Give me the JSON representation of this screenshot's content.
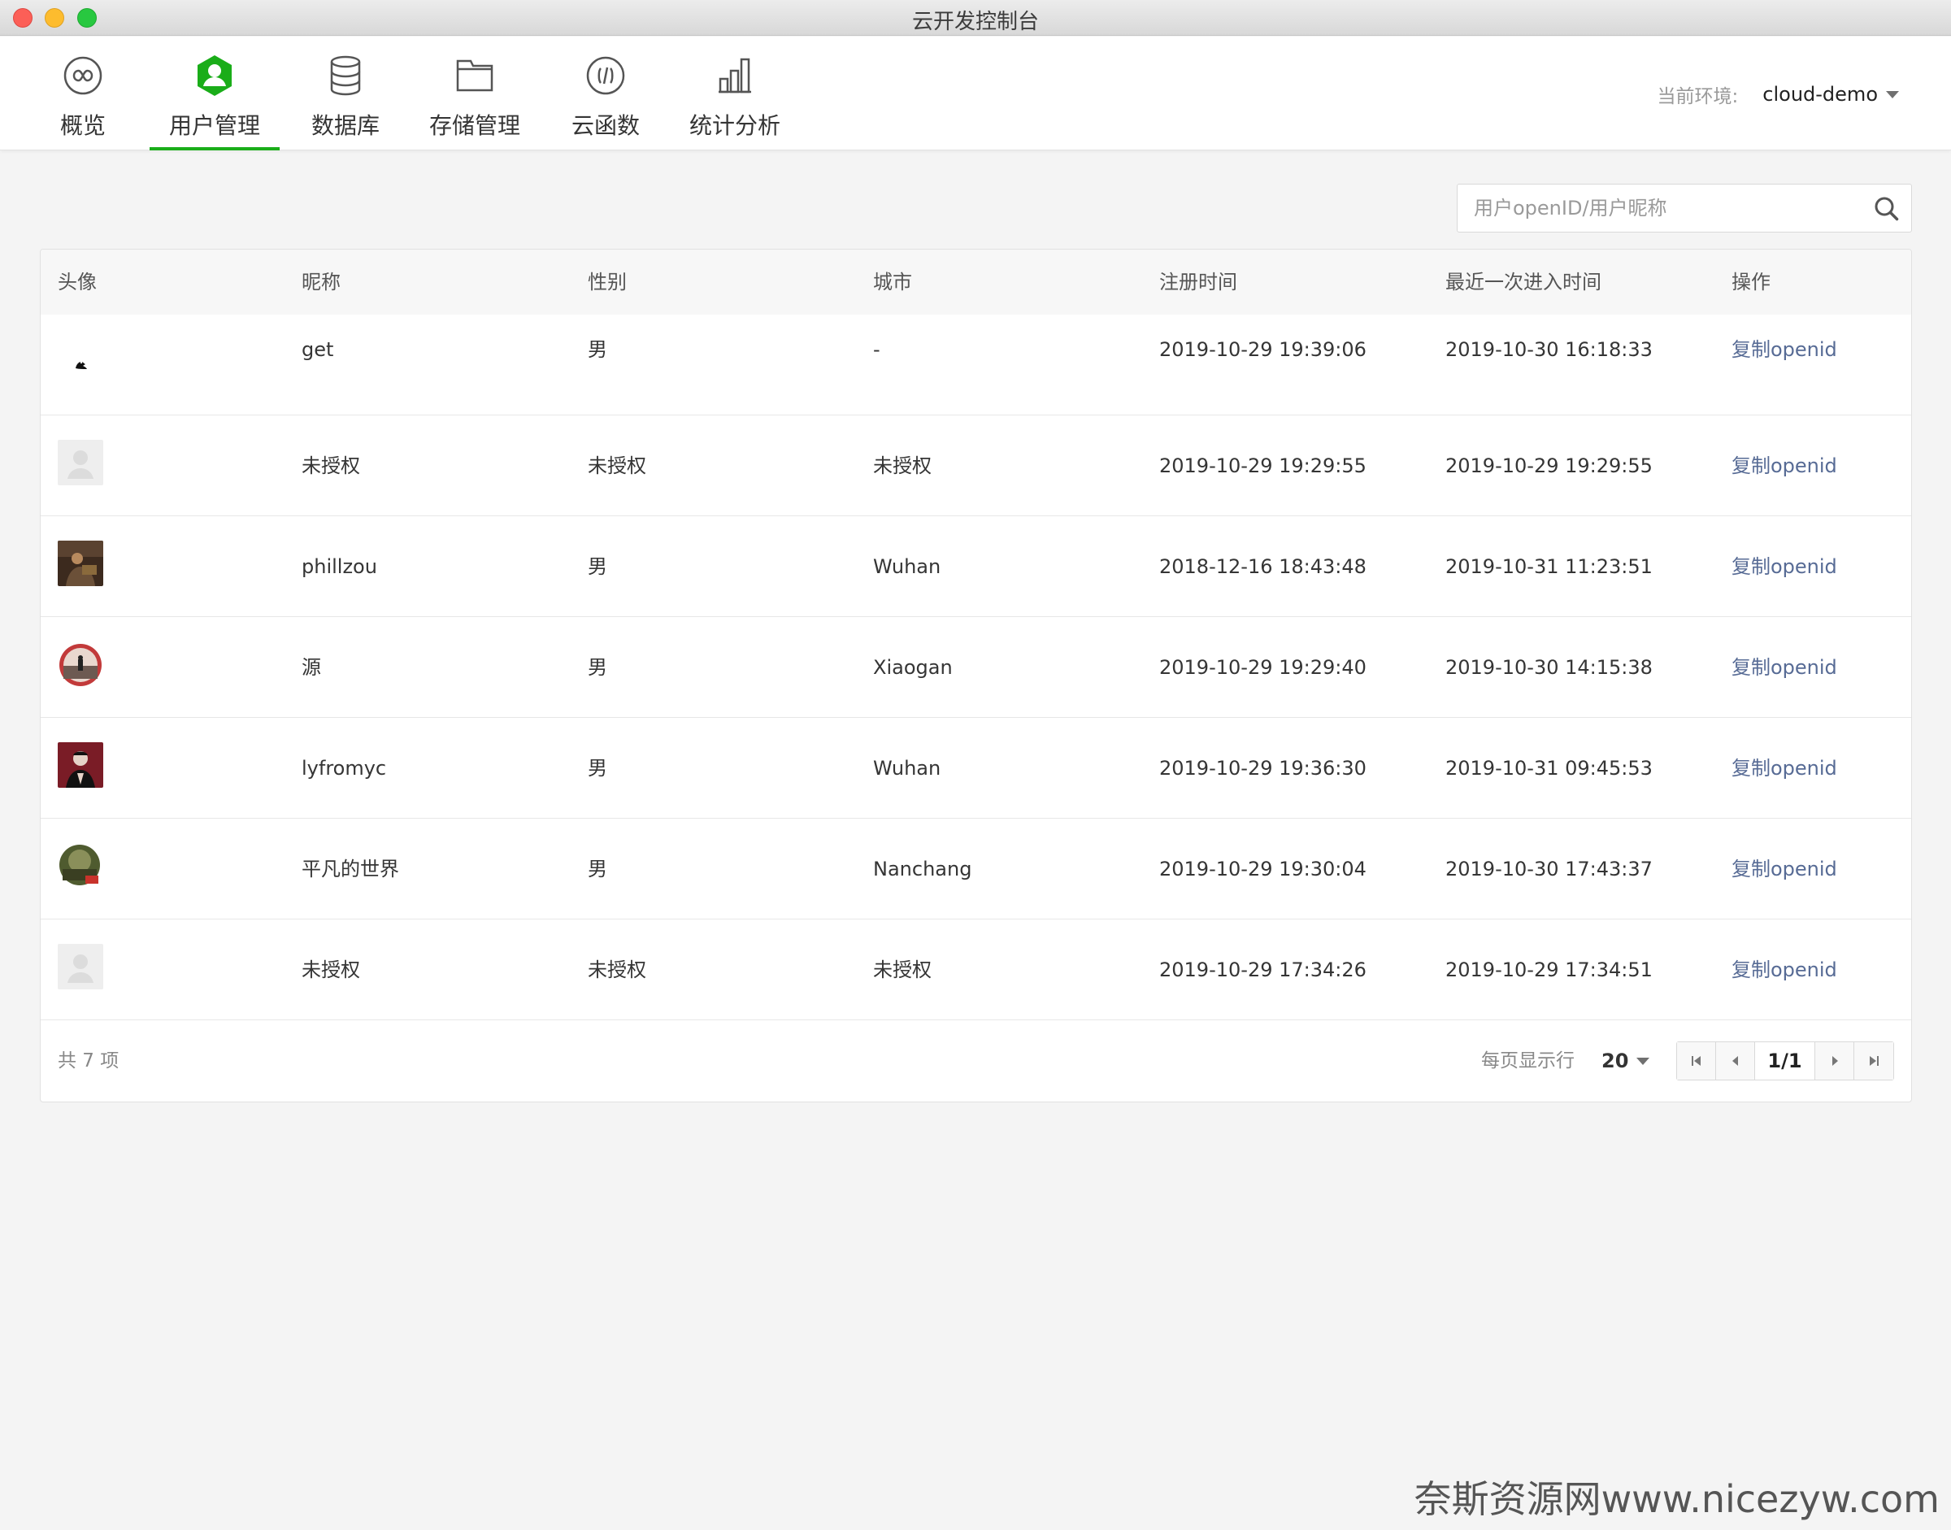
{
  "window": {
    "title": "云开发控制台"
  },
  "nav": {
    "tabs": [
      {
        "label": "概览",
        "icon": "overview-infinity-icon"
      },
      {
        "label": "用户管理",
        "icon": "user-icon",
        "active": true
      },
      {
        "label": "数据库",
        "icon": "database-icon"
      },
      {
        "label": "存储管理",
        "icon": "folder-icon"
      },
      {
        "label": "云函数",
        "icon": "function-icon"
      },
      {
        "label": "统计分析",
        "icon": "chart-icon"
      }
    ],
    "env_label": "当前环境:",
    "env_value": "cloud-demo"
  },
  "search": {
    "placeholder": "用户openID/用户昵称"
  },
  "table": {
    "headers": [
      "头像",
      "昵称",
      "性别",
      "城市",
      "注册时间",
      "最近一次进入时间",
      "操作"
    ],
    "rows": [
      {
        "avatar": "penguin-avatar",
        "nickname": "get",
        "gender": "男",
        "city": "-",
        "registered": "2019-10-29 19:39:06",
        "last_visit": "2019-10-30 16:18:33",
        "action": "复制openid"
      },
      {
        "avatar": "default-avatar",
        "nickname": "未授权",
        "gender": "未授权",
        "city": "未授权",
        "registered": "2019-10-29 19:29:55",
        "last_visit": "2019-10-29 19:29:55",
        "action": "复制openid"
      },
      {
        "avatar": "photo-avatar-brown",
        "nickname": "phillzou",
        "gender": "男",
        "city": "Wuhan",
        "registered": "2018-12-16 18:43:48",
        "last_visit": "2019-10-31 11:23:51",
        "action": "复制openid"
      },
      {
        "avatar": "photo-avatar-red-circle",
        "nickname": "源",
        "gender": "男",
        "city": "Xiaogan",
        "registered": "2019-10-29 19:29:40",
        "last_visit": "2019-10-30 14:15:38",
        "action": "复制openid"
      },
      {
        "avatar": "photo-avatar-dark-red",
        "nickname": "lyfromyc",
        "gender": "男",
        "city": "Wuhan",
        "registered": "2019-10-29 19:36:30",
        "last_visit": "2019-10-31 09:45:53",
        "action": "复制openid"
      },
      {
        "avatar": "photo-avatar-green-circle",
        "nickname": "平凡的世界",
        "gender": "男",
        "city": "Nanchang",
        "registered": "2019-10-29 19:30:04",
        "last_visit": "2019-10-30 17:43:37",
        "action": "复制openid"
      },
      {
        "avatar": "default-avatar",
        "nickname": "未授权",
        "gender": "未授权",
        "city": "未授权",
        "registered": "2019-10-29 17:34:26",
        "last_visit": "2019-10-29 17:34:51",
        "action": "复制openid"
      }
    ]
  },
  "footer": {
    "total": "共 7 项",
    "per_page_label": "每页显示行",
    "per_page_value": "20",
    "page": "1/1"
  },
  "watermark": "奈斯资源网www.nicezyw.com",
  "colors": {
    "accent": "#1aad19",
    "link": "#576b95"
  }
}
